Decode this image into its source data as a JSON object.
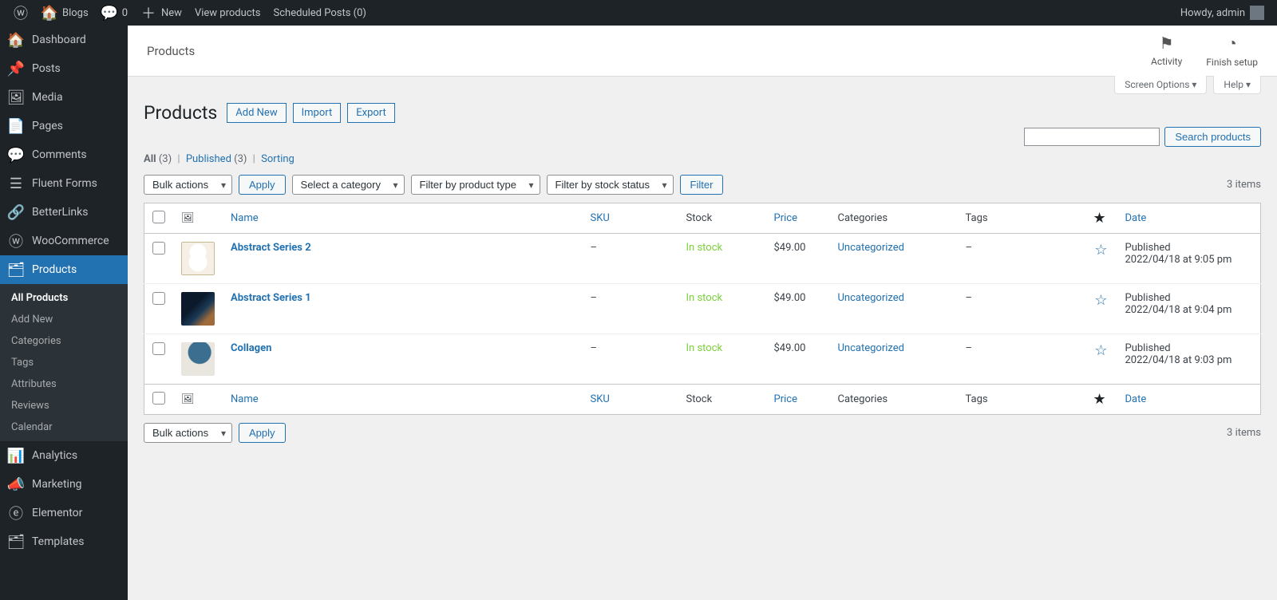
{
  "adminbar": {
    "site": "Blogs",
    "comments": "0",
    "new": "New",
    "view": "View products",
    "scheduled": "Scheduled Posts (0)",
    "howdy": "Howdy, admin"
  },
  "menu": {
    "dashboard": "Dashboard",
    "posts": "Posts",
    "media": "Media",
    "pages": "Pages",
    "comments": "Comments",
    "fluent": "Fluent Forms",
    "betterlinks": "BetterLinks",
    "woo": "WooCommerce",
    "products": "Products",
    "sub": {
      "all": "All Products",
      "add": "Add New",
      "cat": "Categories",
      "tags": "Tags",
      "attr": "Attributes",
      "reviews": "Reviews",
      "calendar": "Calendar"
    },
    "analytics": "Analytics",
    "marketing": "Marketing",
    "elementor": "Elementor",
    "templates": "Templates"
  },
  "wc_header": {
    "crumbs": "Products",
    "activity": "Activity",
    "finish": "Finish setup"
  },
  "screen_meta": {
    "screen_options": "Screen Options ▾",
    "help": "Help ▾"
  },
  "page": {
    "title": "Products",
    "add_new": "Add New",
    "import": "Import",
    "export": "Export"
  },
  "subsubsub": {
    "all_label": "All",
    "all_count": "(3)",
    "published_label": "Published",
    "published_count": "(3)",
    "sorting": "Sorting"
  },
  "filters": {
    "bulk": "Bulk actions",
    "apply": "Apply",
    "category": "Select a category",
    "ptype": "Filter by product type",
    "stock": "Filter by stock status",
    "filter": "Filter",
    "items": "3 items"
  },
  "search": {
    "btn": "Search products"
  },
  "cols": {
    "name": "Name",
    "sku": "SKU",
    "stock": "Stock",
    "price": "Price",
    "categories": "Categories",
    "tags": "Tags",
    "date": "Date"
  },
  "rows": [
    {
      "name": "Abstract Series 2",
      "sku": "–",
      "stock": "In stock",
      "price": "$49.00",
      "cat": "Uncategorized",
      "tags": "–",
      "status": "Published",
      "date": "2022/04/18 at 9:05 pm"
    },
    {
      "name": "Abstract Series 1",
      "sku": "–",
      "stock": "In stock",
      "price": "$49.00",
      "cat": "Uncategorized",
      "tags": "–",
      "status": "Published",
      "date": "2022/04/18 at 9:04 pm"
    },
    {
      "name": "Collagen",
      "sku": "–",
      "stock": "In stock",
      "price": "$49.00",
      "cat": "Uncategorized",
      "tags": "–",
      "status": "Published",
      "date": "2022/04/18 at 9:03 pm"
    }
  ]
}
